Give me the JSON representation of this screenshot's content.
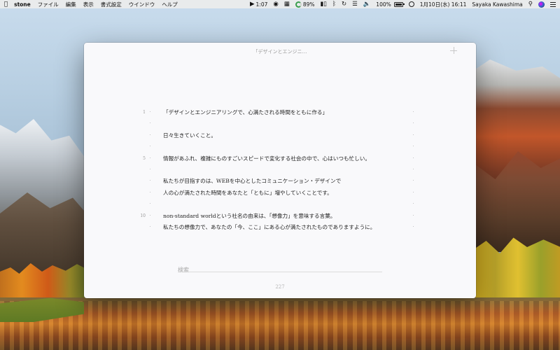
{
  "menubar": {
    "app_name": "stone",
    "menus": [
      "ファイル",
      "編集",
      "表示",
      "書式設定",
      "ウインドウ",
      "ヘルプ"
    ],
    "status": {
      "timer": "1:07",
      "progress_percent": "89%",
      "battery": "100%",
      "datetime": "1月10日(水) 16:11",
      "user": "Sayaka Kawashima"
    },
    "icons": [
      "apple-icon",
      "timer-icon",
      "app-circle-icon",
      "grid-icon",
      "progress-ring-icon",
      "equalizer-icon",
      "bluetooth-icon",
      "time-machine-icon",
      "wifi-icon",
      "volume-icon",
      "battery-icon",
      "airplay-icon",
      "search-icon",
      "siri-icon",
      "list-icon"
    ]
  },
  "window": {
    "title": "「デザインとエンジニ…",
    "gutter_numbers": [
      "1",
      "",
      "",
      "",
      "5",
      "",
      "",
      "",
      "",
      "10",
      ""
    ],
    "lines": [
      "「デザインとエンジニアリングで、心満たされる時間をともに作る」",
      "",
      "日々生きていくこと。",
      "",
      "情報があふれ、複雑にものすごいスピードで変化する社会の中で、心はいつも忙しい。",
      "",
      "私たちが目指すのは、WEBを中心としたコミュニケーション・デザインで",
      "人の心が満たされた時間をあなたと「ともに」増やしていくことです。",
      "",
      "non-standard worldという社名の由来は、「想像力」を意味する言葉。",
      "私たちの想像力で、あなたの「今、ここ」にある心が満たされたものでありますように。"
    ],
    "search_placeholder": "検索",
    "char_count": "227"
  },
  "colors": {
    "window_bg": "#f9f9fb",
    "text": "#222222",
    "muted": "#9a9a9a"
  }
}
